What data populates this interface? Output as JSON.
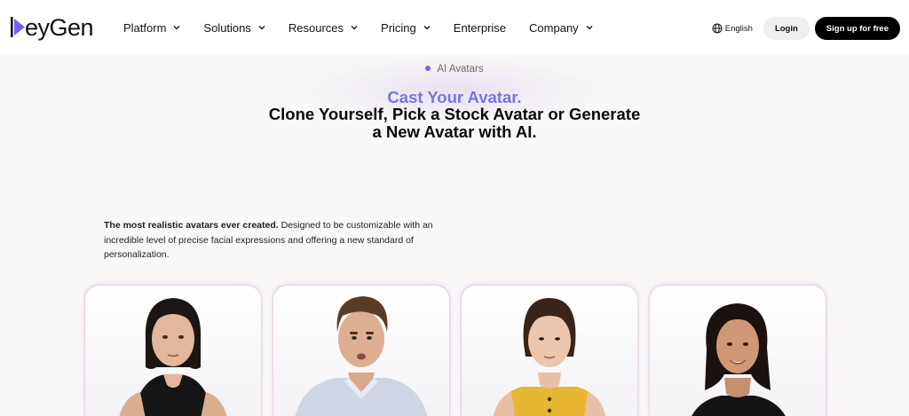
{
  "nav": {
    "logo_text": "HeyGen",
    "menu": [
      {
        "label": "Platform",
        "has_dropdown": true
      },
      {
        "label": "Solutions",
        "has_dropdown": true
      },
      {
        "label": "Resources",
        "has_dropdown": true
      },
      {
        "label": "Pricing",
        "has_dropdown": true
      },
      {
        "label": "Enterprise",
        "has_dropdown": false
      },
      {
        "label": "Company",
        "has_dropdown": true
      }
    ],
    "language": "English",
    "login": "Login",
    "signup": "Sign up for free"
  },
  "hero": {
    "eyebrow": "AI Avatars",
    "accent": "Cast Your Avatar.",
    "headline": "Clone Yourself, Pick a Stock Avatar or Generate a New Avatar with AI."
  },
  "intro": {
    "bold": "The most realistic avatars ever created.",
    "rest": " Designed to be customizable with an incredible level of precise facial expressions and offering a new standard of personalization."
  },
  "avatars": [
    {
      "name": "avatar-woman-black-top"
    },
    {
      "name": "avatar-man-blue-shirt"
    },
    {
      "name": "avatar-woman-yellow-top"
    },
    {
      "name": "avatar-woman-black-dress"
    }
  ],
  "colors": {
    "accent_start": "#5f7fd8",
    "accent_end": "#8a6bdf",
    "eyebrow_dot": "#7a66d8",
    "signup_bg": "#000000",
    "login_bg": "#efefef"
  }
}
